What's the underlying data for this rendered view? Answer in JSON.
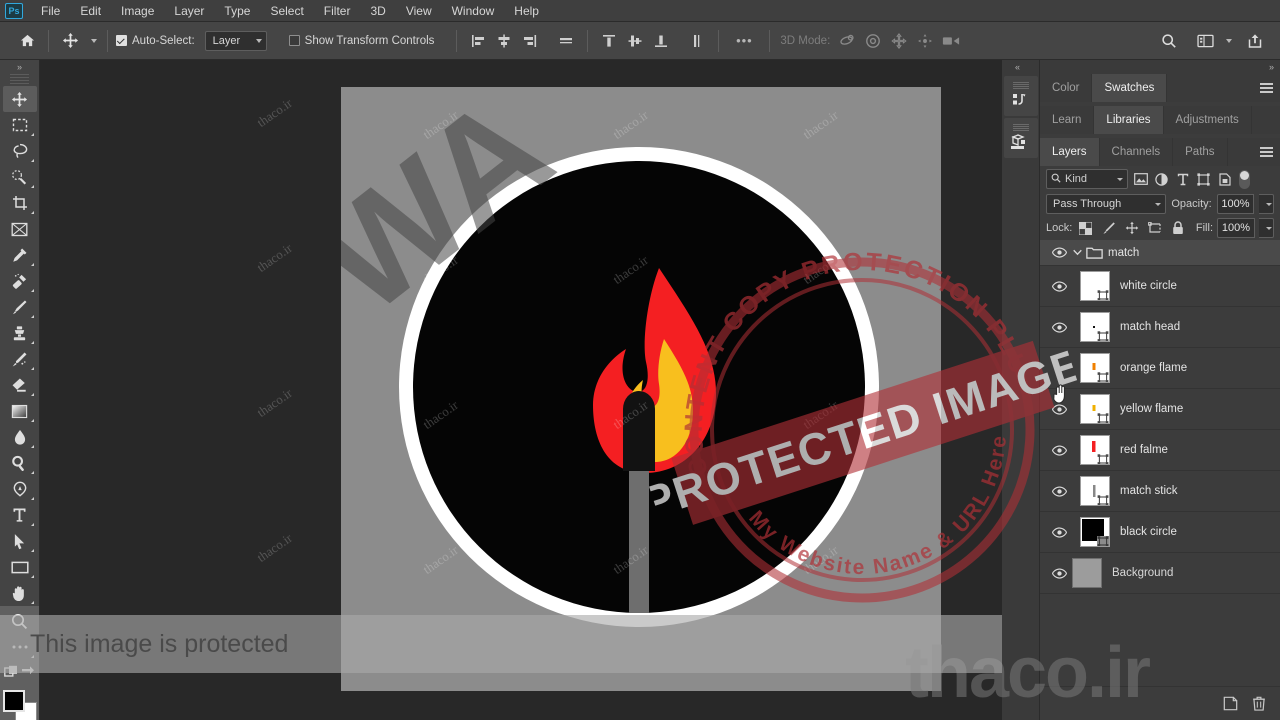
{
  "app": {
    "logo": "Ps"
  },
  "menubar": {
    "items": [
      "File",
      "Edit",
      "Image",
      "Layer",
      "Type",
      "Select",
      "Filter",
      "3D",
      "View",
      "Window",
      "Help"
    ]
  },
  "optionsbar": {
    "home_icon": "home-icon",
    "tool_icon": "move-tool-icon",
    "auto_select_label": "Auto-Select:",
    "auto_select_checked": true,
    "auto_select_scope": "Layer",
    "show_transform_label": "Show Transform Controls",
    "show_transform_checked": false,
    "align_icons": [
      "align-left-edges-icon",
      "align-horizontal-centers-icon",
      "align-right-edges-icon",
      "distribute-horizontal-icon"
    ],
    "align_icons2": [
      "align-top-edges-icon",
      "align-vertical-centers-icon",
      "align-bottom-edges-icon",
      "distribute-vertical-icon"
    ],
    "more_label": "•••",
    "mode_3d_label": "3D Mode:",
    "mode_3d_icons": [
      "orbit-3d-icon",
      "roll-3d-icon",
      "pan-3d-icon",
      "slide-3d-icon",
      "scale-3d-icon"
    ],
    "search_icon": "search-icon",
    "workspace_icon": "workspace-icon",
    "share_icon": "share-icon"
  },
  "toolbar": {
    "collapse_icon": "collapse-panel-icon",
    "tools": [
      {
        "name": "move-tool",
        "icon": "move-icon",
        "active": true,
        "corner": false
      },
      {
        "name": "rectangular-marquee-tool",
        "icon": "marquee-icon",
        "active": false,
        "corner": true
      },
      {
        "name": "lasso-tool",
        "icon": "lasso-icon",
        "active": false,
        "corner": true
      },
      {
        "name": "quick-selection-tool",
        "icon": "quick-select-icon",
        "active": false,
        "corner": true
      },
      {
        "name": "crop-tool",
        "icon": "crop-icon",
        "active": false,
        "corner": true
      },
      {
        "name": "frame-tool",
        "icon": "frame-icon",
        "active": false,
        "corner": false
      },
      {
        "name": "eyedropper-tool",
        "icon": "eyedropper-icon",
        "active": false,
        "corner": true
      },
      {
        "name": "spot-healing-brush-tool",
        "icon": "healing-brush-icon",
        "active": false,
        "corner": true
      },
      {
        "name": "brush-tool",
        "icon": "brush-icon",
        "active": false,
        "corner": true
      },
      {
        "name": "clone-stamp-tool",
        "icon": "clone-stamp-icon",
        "active": false,
        "corner": true
      },
      {
        "name": "history-brush-tool",
        "icon": "history-brush-icon",
        "active": false,
        "corner": true
      },
      {
        "name": "eraser-tool",
        "icon": "eraser-icon",
        "active": false,
        "corner": true
      },
      {
        "name": "gradient-tool",
        "icon": "gradient-icon",
        "active": false,
        "corner": true
      },
      {
        "name": "blur-tool",
        "icon": "blur-droplet-icon",
        "active": false,
        "corner": true
      },
      {
        "name": "dodge-tool",
        "icon": "dodge-icon",
        "active": false,
        "corner": true
      },
      {
        "name": "pen-tool",
        "icon": "pen-icon",
        "active": false,
        "corner": true
      },
      {
        "name": "type-tool",
        "icon": "type-icon",
        "active": false,
        "corner": true
      },
      {
        "name": "path-selection-tool",
        "icon": "path-selection-arrow-icon",
        "active": false,
        "corner": true
      },
      {
        "name": "rectangle-tool",
        "icon": "rectangle-icon",
        "active": false,
        "corner": true
      },
      {
        "name": "hand-tool",
        "icon": "hand-icon",
        "active": false,
        "corner": true
      },
      {
        "name": "zoom-tool",
        "icon": "zoom-magnifier-icon",
        "active": false,
        "corner": false
      },
      {
        "name": "edit-toolbar",
        "icon": "ellipsis-icon",
        "active": false,
        "corner": false
      },
      {
        "name": "quick-mask-mode",
        "icon": "quick-mask-icon",
        "active": false,
        "corner": false
      },
      {
        "name": "screen-mode",
        "icon": "screen-mode-icon",
        "active": false,
        "corner": false
      }
    ],
    "foreground_color": "#000000",
    "background_color": "#ffffff"
  },
  "canvas": {
    "artwork_title": "match-with-flame-icon",
    "background_color": "#8c8c8c",
    "circle_outer_color": "#ffffff",
    "circle_inner_color": "#050505",
    "flame_red": "#f41f22",
    "flame_yellow": "#f8bf1e",
    "match_stick_color": "#6e6e6e",
    "match_head_color": "#121212",
    "watermark_tile_text": "thaco.ir",
    "watermark_big_text": "WA"
  },
  "overlays": {
    "protected_banner_text": "This image is protected",
    "bottom_watermark_text": "thaco.ir",
    "stamp": {
      "center_text": "PROTECTED IMAGE",
      "ring_top_text": "WP CONTENT COPY PROTECTION PLUGIN",
      "ring_bottom_text": "My Website Name & URL Here",
      "color": "#b03036"
    }
  },
  "rightdock": {
    "rail_buttons": [
      {
        "name": "history-panel-icon",
        "label": "history"
      },
      {
        "name": "3d-panel-icon",
        "label": "3d"
      }
    ],
    "collapse_icon": "expand-panels-icon",
    "group_color": {
      "tabs": [
        "Color",
        "Swatches"
      ],
      "active": "Swatches"
    },
    "group_libraries": {
      "tabs": [
        "Learn",
        "Libraries",
        "Adjustments"
      ],
      "active": "Libraries"
    },
    "group_layers": {
      "tabs": [
        "Layers",
        "Channels",
        "Paths"
      ],
      "active": "Layers"
    },
    "menu_icon": "panel-menu-icon"
  },
  "layers_panel": {
    "filter": {
      "search_icon": "search-icon",
      "kind_label": "Kind",
      "filter_icons": [
        "pixel-layer-filter-icon",
        "adjustment-layer-filter-icon",
        "type-layer-filter-icon",
        "shape-layer-filter-icon",
        "smart-object-filter-icon"
      ],
      "toggle_name": "filter-enable-toggle"
    },
    "blend_mode": "Pass Through",
    "opacity_label": "Opacity:",
    "opacity_value": "100%",
    "lock_label": "Lock:",
    "lock_icons": [
      "lock-transparent-pixels-icon",
      "lock-image-pixels-icon",
      "lock-position-icon",
      "lock-artboard-nesting-icon",
      "lock-all-icon"
    ],
    "fill_label": "Fill:",
    "fill_value": "100%",
    "layers": [
      {
        "name": "match",
        "type": "group",
        "visible": true,
        "expanded": true,
        "thumb": "folder",
        "vector_mask": false
      },
      {
        "name": "white circle",
        "type": "shape",
        "visible": true,
        "expanded": false,
        "thumb": "white",
        "vector_mask": true
      },
      {
        "name": "match head",
        "type": "shape",
        "visible": true,
        "expanded": false,
        "thumb": "match-head",
        "vector_mask": true
      },
      {
        "name": "orange flame",
        "type": "shape",
        "visible": true,
        "expanded": false,
        "thumb": "orange",
        "vector_mask": true
      },
      {
        "name": "yellow flame",
        "type": "shape",
        "visible": true,
        "expanded": false,
        "thumb": "yellow",
        "vector_mask": true
      },
      {
        "name": "red falme",
        "type": "shape",
        "visible": true,
        "expanded": false,
        "thumb": "red",
        "vector_mask": true
      },
      {
        "name": "match stick",
        "type": "shape",
        "visible": true,
        "expanded": false,
        "thumb": "stick",
        "vector_mask": true
      },
      {
        "name": "black circle",
        "type": "shape",
        "visible": true,
        "expanded": false,
        "thumb": "black",
        "vector_mask": true
      },
      {
        "name": "Background",
        "type": "raster",
        "visible": true,
        "expanded": false,
        "thumb": "gray",
        "vector_mask": false
      }
    ],
    "bottom_buttons": [
      "new-layer-icon",
      "delete-layer-icon"
    ]
  }
}
